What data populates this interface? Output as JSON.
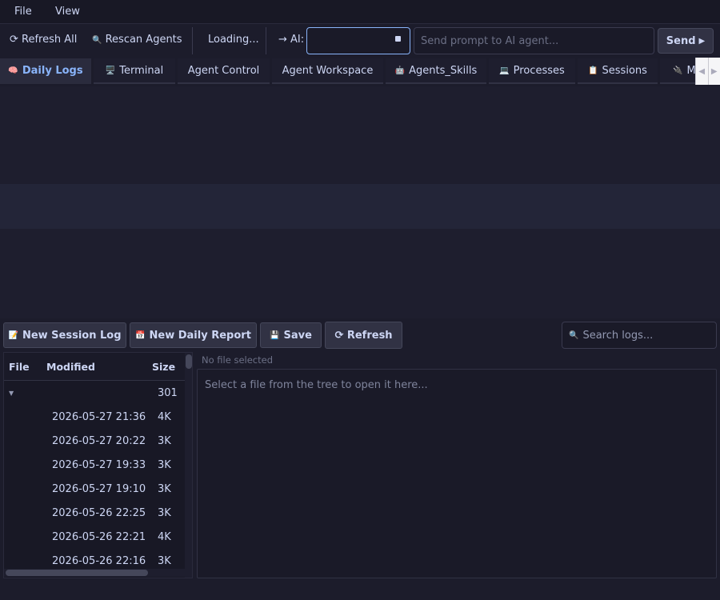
{
  "menu": {
    "file": "File",
    "view": "View"
  },
  "toolbar": {
    "refresh_all": "⟳ Refresh All",
    "rescan_agents": "Rescan Agents",
    "loading": "Loading...",
    "ai_label": "→ AI:",
    "prompt_placeholder": "Send prompt to AI agent...",
    "send_label": "Send"
  },
  "tabs": [
    {
      "label": "Daily Logs",
      "icon": "🧠"
    },
    {
      "label": "Terminal",
      "icon": "🖥️"
    },
    {
      "label": "Agent Control",
      "icon": ""
    },
    {
      "label": "Agent Workspace",
      "icon": ""
    },
    {
      "label": "Agents_Skills",
      "icon": "🤖"
    },
    {
      "label": "Processes",
      "icon": "💻"
    },
    {
      "label": "Sessions",
      "icon": "📋"
    },
    {
      "label": "M",
      "icon": "🔌"
    }
  ],
  "actions": {
    "new_session_log": "New Session Log",
    "new_daily_report": "New Daily Report",
    "save": "Save",
    "refresh": "⟳ Refresh",
    "search_placeholder": "Search logs..."
  },
  "tree": {
    "columns": {
      "file": "File",
      "modified": "Modified",
      "size": "Size"
    },
    "group": {
      "name": "",
      "size": "301"
    },
    "rows": [
      {
        "modified": "2026-05-27 21:36",
        "size": "4K"
      },
      {
        "modified": "2026-05-27 20:22",
        "size": "3K"
      },
      {
        "modified": "2026-05-27 19:33",
        "size": "3K"
      },
      {
        "modified": "2026-05-27 19:10",
        "size": "3K"
      },
      {
        "modified": "2026-05-26 22:25",
        "size": "3K"
      },
      {
        "modified": "2026-05-26 22:21",
        "size": "4K"
      },
      {
        "modified": "2026-05-26 22:16",
        "size": "3K"
      }
    ]
  },
  "viewer": {
    "status": "No file selected",
    "placeholder": "Select a file from the tree to open it here..."
  },
  "colors": {
    "accent": "#89b4fa",
    "background": "#1e1e2e",
    "surface": "#313244"
  }
}
